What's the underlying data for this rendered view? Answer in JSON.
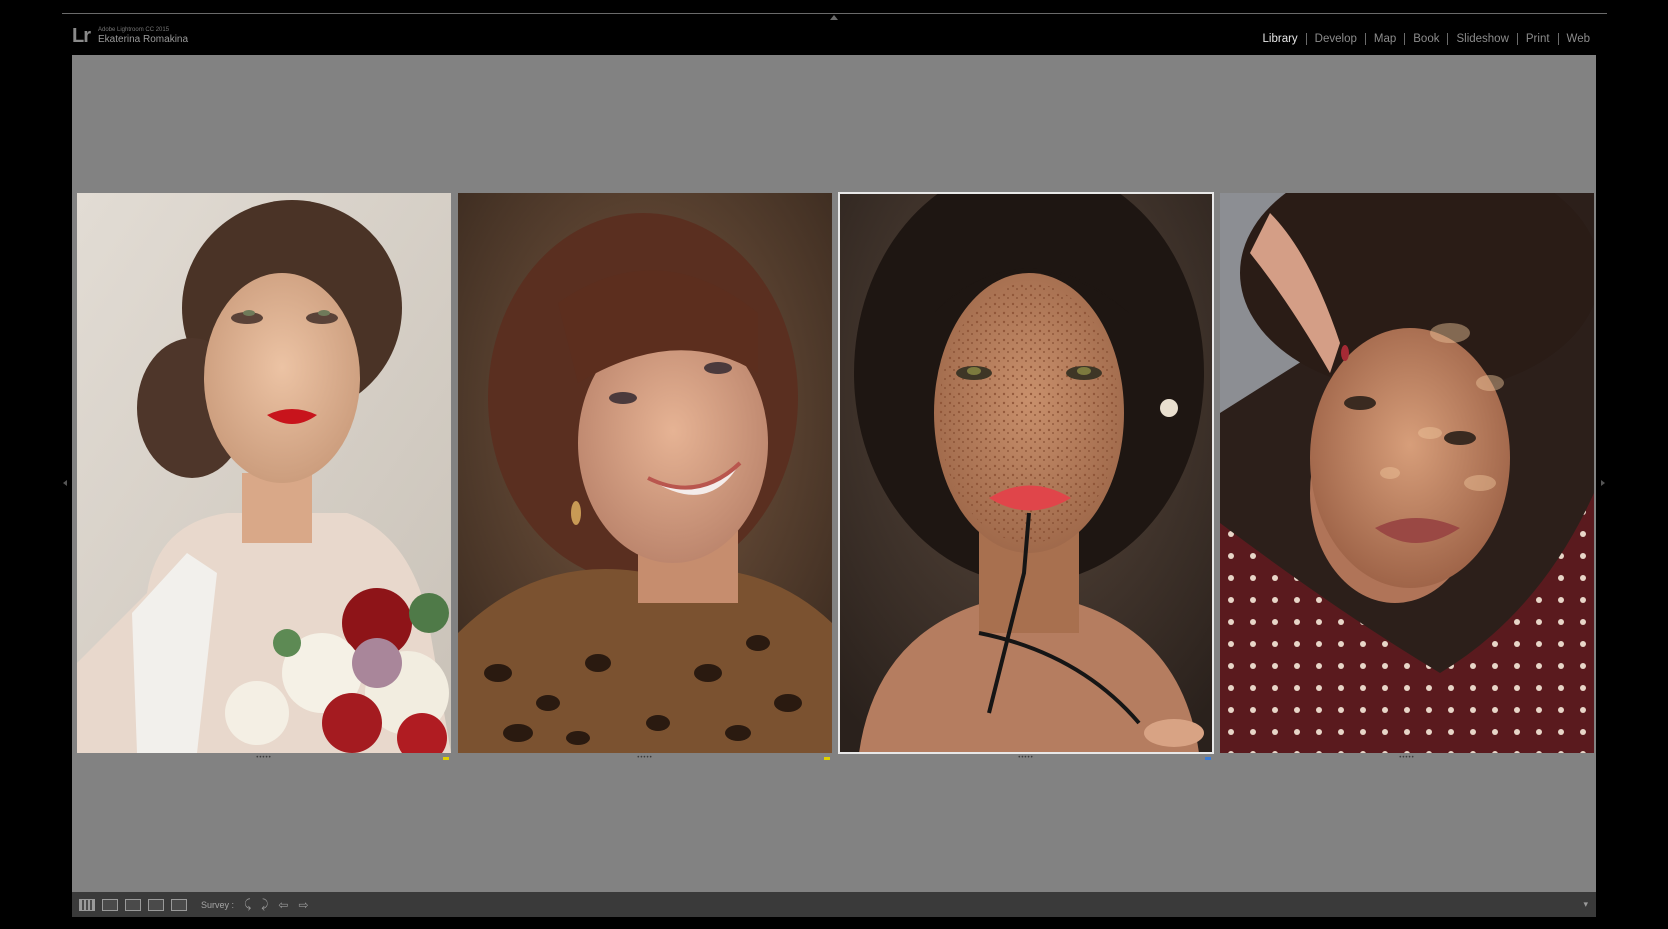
{
  "app": {
    "product": "Adobe Lightroom CC 2015",
    "user": "Ekaterina Romakina",
    "logo": "Lr"
  },
  "modules": [
    {
      "label": "Library",
      "active": true
    },
    {
      "label": "Develop",
      "active": false
    },
    {
      "label": "Map",
      "active": false
    },
    {
      "label": "Book",
      "active": false
    },
    {
      "label": "Slideshow",
      "active": false
    },
    {
      "label": "Print",
      "active": false
    },
    {
      "label": "Web",
      "active": false
    }
  ],
  "survey": {
    "photos": [
      {
        "stars": "•••••",
        "flag_color": "#e0d000",
        "selected": false
      },
      {
        "stars": "•••••",
        "flag_color": "#e0d000",
        "selected": false
      },
      {
        "stars": "•••••",
        "flag_color": "#3a7bd5",
        "selected": true
      },
      {
        "stars": "•••••",
        "flag_color": "",
        "selected": false
      }
    ]
  },
  "toolbar": {
    "mode_label": "Survey :",
    "icons": [
      "grid-view-icon",
      "loupe-view-icon",
      "compare-view-icon",
      "survey-view-icon",
      "people-view-icon",
      "rotate-left-icon",
      "rotate-right-icon",
      "previous-arrow-icon",
      "next-arrow-icon"
    ],
    "rotate_left": "⤹",
    "rotate_right": "⤸",
    "prev": "⇦",
    "next": "⇨",
    "menu": "▾"
  },
  "colors": {
    "background": "#000000",
    "workspace": "#828282",
    "toolbar": "#3a3a3a",
    "active_module": "#e6e6e6"
  }
}
